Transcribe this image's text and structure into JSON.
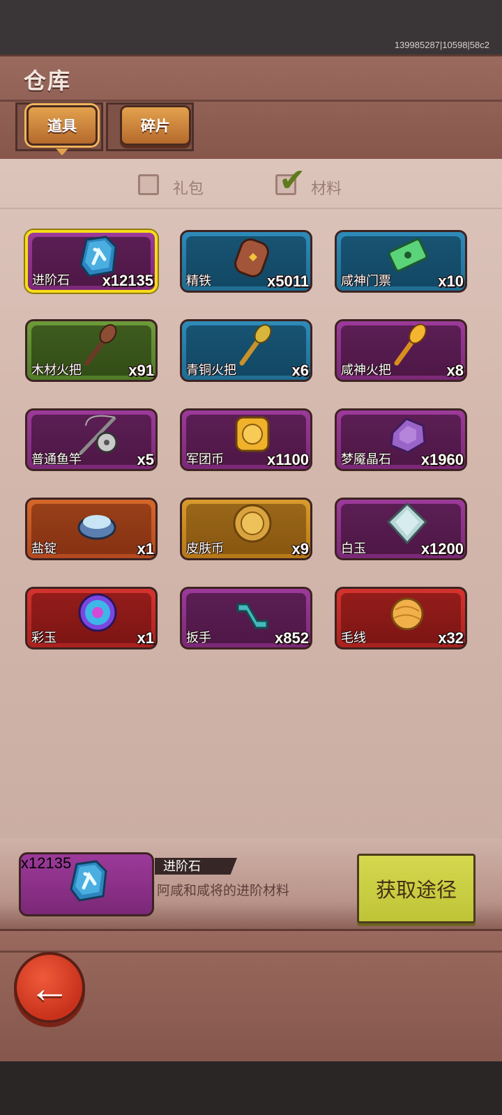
{
  "build_id": "139985287|10598|58c2",
  "title": "仓库",
  "tabs": [
    {
      "label": "道具",
      "selected": true
    },
    {
      "label": "碎片",
      "selected": false
    }
  ],
  "filters": [
    {
      "label": "礼包",
      "checked": false
    },
    {
      "label": "材料",
      "checked": true
    }
  ],
  "items": [
    {
      "name": "进阶石",
      "count": "x12135",
      "rarity": "purple",
      "icon": "rune-stone-icon",
      "selected": true
    },
    {
      "name": "精铁",
      "count": "x5011",
      "rarity": "blue",
      "icon": "iron-ingot-icon"
    },
    {
      "name": "咸神门票",
      "count": "x10",
      "rarity": "blue",
      "icon": "ticket-icon"
    },
    {
      "name": "木材火把",
      "count": "x91",
      "rarity": "green",
      "icon": "wood-torch-icon"
    },
    {
      "name": "青铜火把",
      "count": "x6",
      "rarity": "blue",
      "icon": "bronze-torch-icon"
    },
    {
      "name": "咸神火把",
      "count": "x8",
      "rarity": "purple",
      "icon": "gold-torch-icon"
    },
    {
      "name": "普通鱼竿",
      "count": "x5",
      "rarity": "purple",
      "icon": "fishing-rod-icon"
    },
    {
      "name": "军团币",
      "count": "x1100",
      "rarity": "purple",
      "icon": "legion-coin-icon"
    },
    {
      "name": "梦魇晶石",
      "count": "x1960",
      "rarity": "purple",
      "icon": "nightmare-crystal-icon"
    },
    {
      "name": "盐锭",
      "count": "x1",
      "rarity": "orange",
      "icon": "salt-ingot-icon"
    },
    {
      "name": "皮肤币",
      "count": "x9",
      "rarity": "gold",
      "icon": "skin-coin-icon"
    },
    {
      "name": "白玉",
      "count": "x1200",
      "rarity": "purple",
      "icon": "white-jade-icon"
    },
    {
      "name": "彩玉",
      "count": "x1",
      "rarity": "red",
      "icon": "rainbow-jade-icon"
    },
    {
      "name": "扳手",
      "count": "x852",
      "rarity": "purple",
      "icon": "wrench-icon"
    },
    {
      "name": "毛线",
      "count": "x32",
      "rarity": "red",
      "icon": "yarn-ball-icon"
    }
  ],
  "detail": {
    "name": "进阶石",
    "count": "x12135",
    "description": "阿咸和咸将的进阶材料",
    "obtain_label": "获取途径"
  },
  "colors": {
    "purple": "#8e3390",
    "blue": "#2a7fab",
    "green": "#5f8c30",
    "orange": "#c85926",
    "gold": "#c98a22",
    "red": "#c02b27",
    "selected_border": "#f7dc17",
    "obtain_button": "#c8cd40",
    "back_button": "#e0472c"
  }
}
